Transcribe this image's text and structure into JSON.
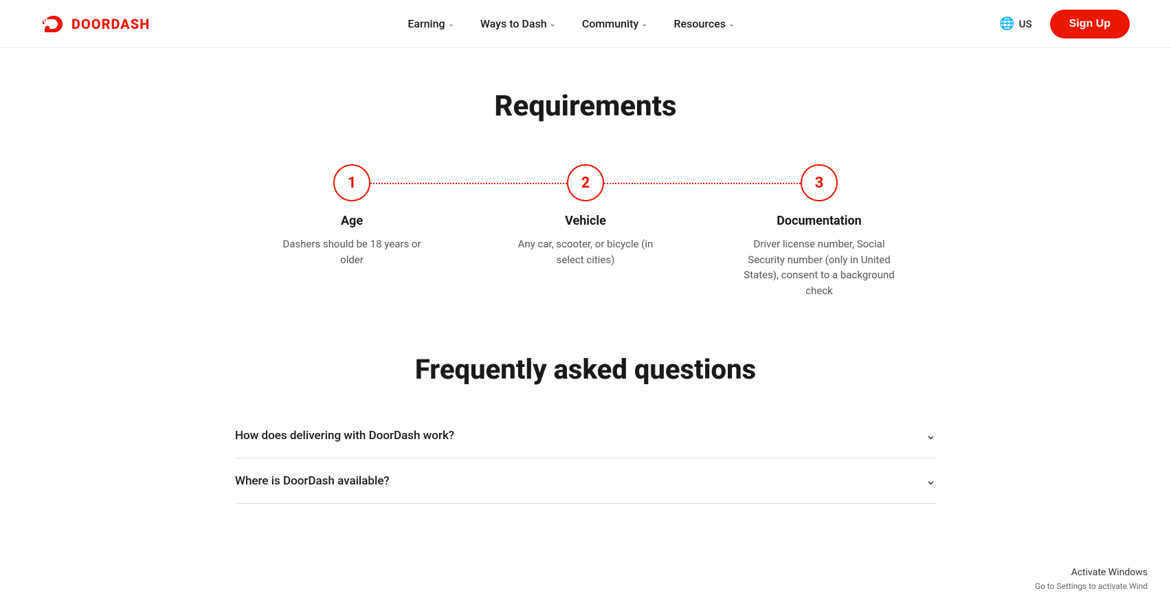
{
  "header": {
    "logo_text": "DOORDASH",
    "nav_items": [
      {
        "label": "Earning",
        "id": "earning"
      },
      {
        "label": "Ways to Dash",
        "id": "ways-to-dash"
      },
      {
        "label": "Community",
        "id": "community"
      },
      {
        "label": "Resources",
        "id": "resources"
      }
    ],
    "locale": "US",
    "signup_label": "Sign Up"
  },
  "requirements": {
    "title": "Requirements",
    "steps": [
      {
        "number": "1",
        "label": "Age",
        "description": "Dashers should be 18 years or older"
      },
      {
        "number": "2",
        "label": "Vehicle",
        "description": "Any car, scooter, or bicycle (in select cities)"
      },
      {
        "number": "3",
        "label": "Documentation",
        "description": "Driver license number, Social Security number (only in United States), consent to a background check"
      }
    ]
  },
  "faq": {
    "title": "Frequently asked questions",
    "items": [
      {
        "question": "How does delivering with DoorDash work?"
      },
      {
        "question": "Where is DoorDash available?"
      }
    ]
  },
  "windows_watermark": {
    "line1": "Activate Windows",
    "line2": "Go to Settings to activate Wind"
  }
}
